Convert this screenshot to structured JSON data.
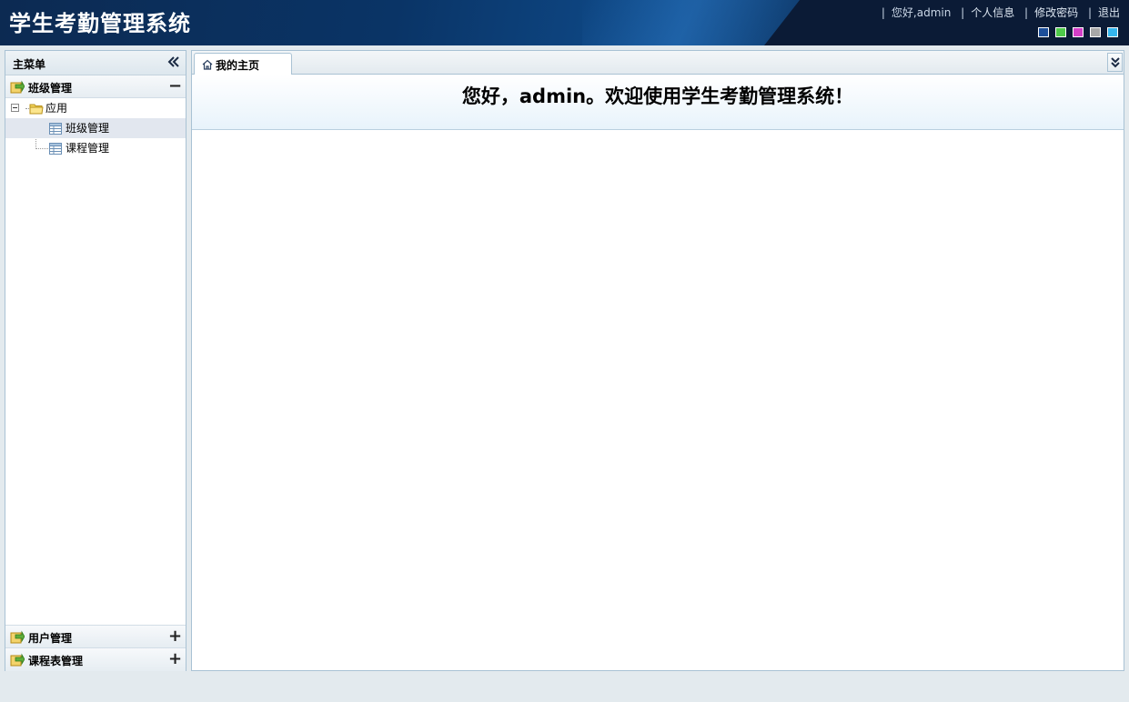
{
  "header": {
    "title": "学生考勤管理系统",
    "greeting": "您好,admin",
    "links": [
      "个人信息",
      "修改密码",
      "退出"
    ],
    "theme_colors": [
      "#1d4f9a",
      "#4fc94a",
      "#d43fc7",
      "#a8a8a8",
      "#35b6ee"
    ]
  },
  "sidebar": {
    "title": "主菜单",
    "sections": [
      {
        "label": "班级管理",
        "expanded": true,
        "tool": "−"
      },
      {
        "label": "用户管理",
        "expanded": false,
        "tool": "+"
      },
      {
        "label": "课程表管理",
        "expanded": false,
        "tool": "+"
      }
    ],
    "tree": {
      "root": "应用",
      "children": [
        "班级管理",
        "课程管理"
      ]
    }
  },
  "tabs": [
    {
      "label": "我的主页",
      "active": true
    }
  ],
  "main": {
    "welcome": "您好，admin。欢迎使用学生考勤管理系统！"
  }
}
